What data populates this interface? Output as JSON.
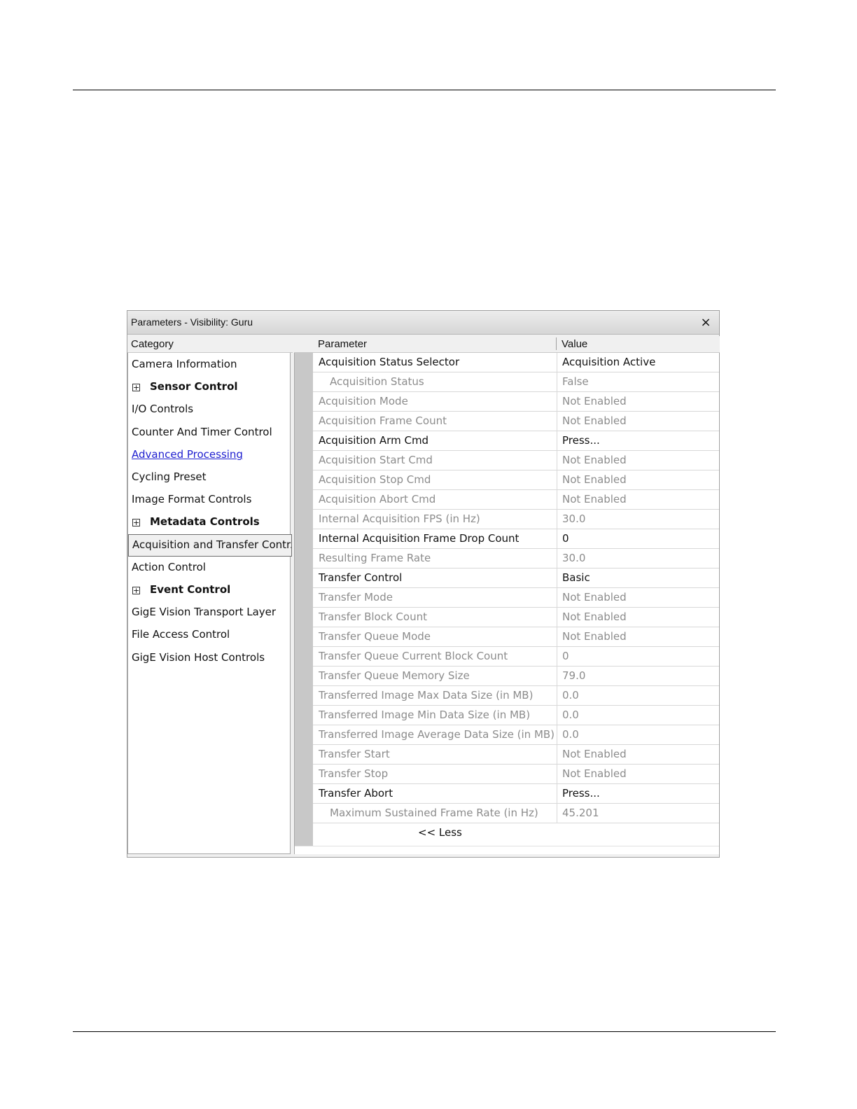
{
  "window": {
    "title": "Parameters - Visibility: Guru",
    "close_glyph": "×"
  },
  "headers": {
    "category": "Category",
    "parameter": "Parameter",
    "value": "Value"
  },
  "categories": [
    {
      "label": "Camera Information",
      "expandable": false
    },
    {
      "label": "Sensor Control",
      "expandable": true
    },
    {
      "label": "I/O Controls",
      "expandable": false
    },
    {
      "label": "Counter And Timer Control",
      "expandable": false
    },
    {
      "label": "Advanced Processing",
      "expandable": false,
      "link": true
    },
    {
      "label": "Cycling Preset",
      "expandable": false
    },
    {
      "label": "Image Format Controls",
      "expandable": false
    },
    {
      "label": "Metadata Controls",
      "expandable": true
    },
    {
      "label": "Acquisition and Transfer Contr...",
      "expandable": false,
      "selected": true
    },
    {
      "label": "Action Control",
      "expandable": false
    },
    {
      "label": "Event Control",
      "expandable": true
    },
    {
      "label": "GigE Vision Transport Layer",
      "expandable": false
    },
    {
      "label": "File Access Control",
      "expandable": false
    },
    {
      "label": "GigE Vision Host Controls",
      "expandable": false
    }
  ],
  "parameters": [
    {
      "name": "Acquisition Status Selector",
      "value": "Acquisition Active",
      "enabled": true
    },
    {
      "name": "Acquisition Status",
      "value": "False",
      "enabled": false,
      "indent": true
    },
    {
      "name": "Acquisition Mode",
      "value": "Not Enabled",
      "enabled": false
    },
    {
      "name": "Acquisition Frame Count",
      "value": "Not Enabled",
      "enabled": false
    },
    {
      "name": "Acquisition Arm Cmd",
      "value": "Press...",
      "enabled": true
    },
    {
      "name": "Acquisition Start Cmd",
      "value": "Not Enabled",
      "enabled": false
    },
    {
      "name": "Acquisition Stop Cmd",
      "value": "Not Enabled",
      "enabled": false
    },
    {
      "name": "Acquisition Abort Cmd",
      "value": "Not Enabled",
      "enabled": false
    },
    {
      "name": "Internal Acquisition FPS (in Hz)",
      "value": "30.0",
      "enabled": false
    },
    {
      "name": "Internal Acquisition Frame Drop Count",
      "value": "0",
      "enabled": true
    },
    {
      "name": "Resulting Frame Rate",
      "value": "30.0",
      "enabled": false
    },
    {
      "name": "Transfer Control",
      "value": "Basic",
      "enabled": true
    },
    {
      "name": "Transfer Mode",
      "value": "Not Enabled",
      "enabled": false
    },
    {
      "name": "Transfer Block Count",
      "value": "Not Enabled",
      "enabled": false
    },
    {
      "name": "Transfer Queue Mode",
      "value": "Not Enabled",
      "enabled": false
    },
    {
      "name": "Transfer Queue Current Block Count",
      "value": "0",
      "enabled": false
    },
    {
      "name": "Transfer Queue Memory Size",
      "value": "79.0",
      "enabled": false
    },
    {
      "name": "Transferred Image Max Data Size (in MB)",
      "value": "0.0",
      "enabled": false
    },
    {
      "name": "Transferred Image Min Data Size (in MB)",
      "value": "0.0",
      "enabled": false
    },
    {
      "name": "Transferred Image Average Data Size (in MB)",
      "value": "0.0",
      "enabled": false
    },
    {
      "name": "Transfer Start",
      "value": "Not Enabled",
      "enabled": false
    },
    {
      "name": "Transfer Stop",
      "value": "Not Enabled",
      "enabled": false
    },
    {
      "name": "Transfer Abort",
      "value": "Press...",
      "enabled": true
    },
    {
      "name": "Maximum Sustained Frame Rate (in Hz)",
      "value": "45.201",
      "enabled": false,
      "indent": true
    }
  ],
  "less_label": "<< Less",
  "colors": {
    "link": "#2020d0",
    "disabled_text": "#8c8c8c",
    "active_text": "#111111",
    "gutter": "#c8c8c8"
  }
}
